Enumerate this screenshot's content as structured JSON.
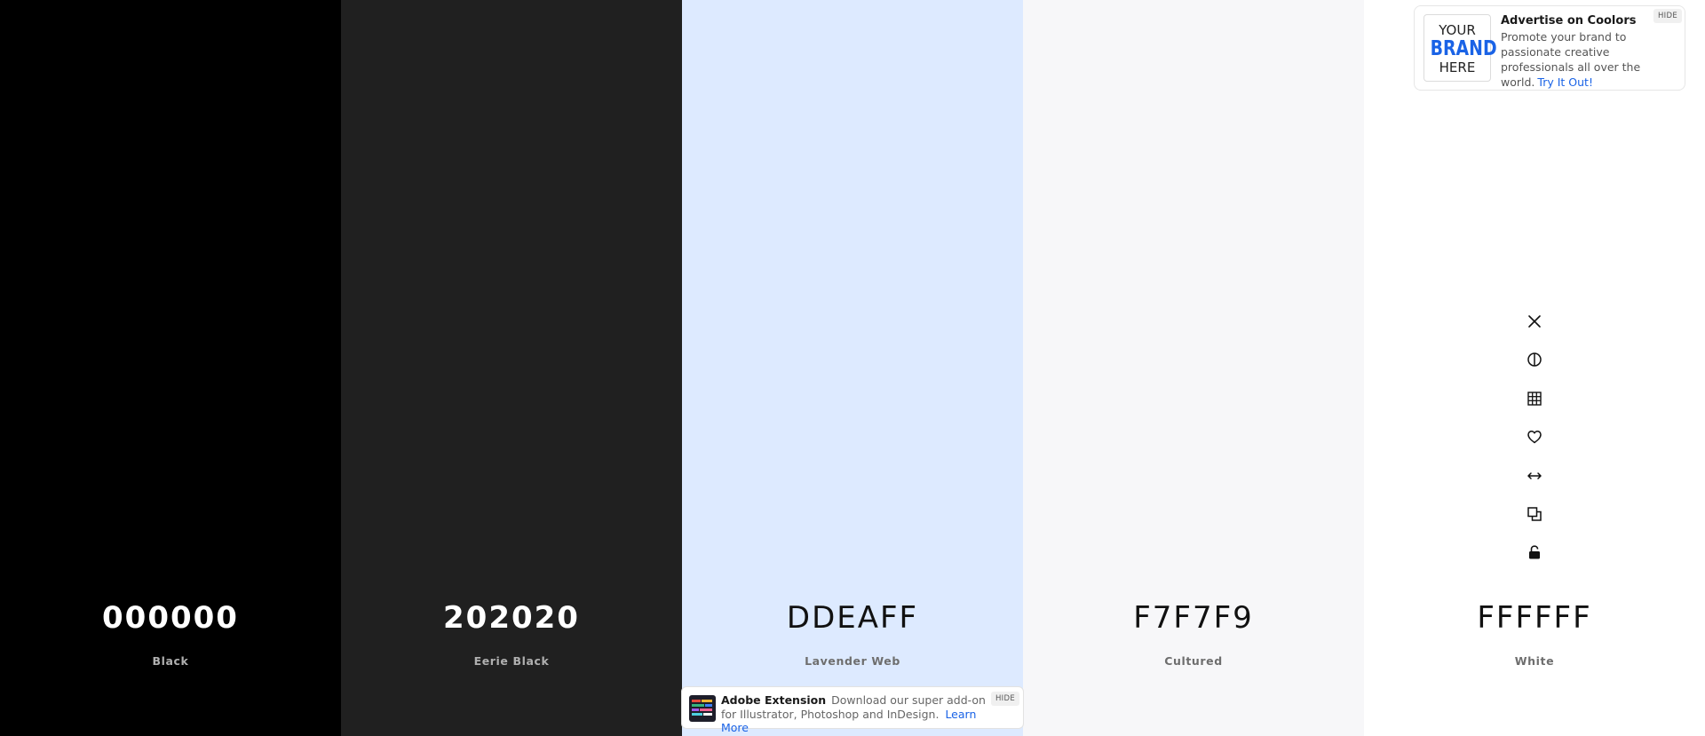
{
  "palette": [
    {
      "hex": "000000",
      "name": "Black",
      "color": "#000000",
      "tone": "dark"
    },
    {
      "hex": "202020",
      "name": "Eerie Black",
      "color": "#202020",
      "tone": "dark"
    },
    {
      "hex": "DDEAFF",
      "name": "Lavender Web",
      "color": "#DDEAFF",
      "tone": "light"
    },
    {
      "hex": "F7F7F9",
      "name": "Cultured",
      "color": "#F7F7F9",
      "tone": "light"
    },
    {
      "hex": "FFFFFF",
      "name": "White",
      "color": "#FFFFFF",
      "tone": "light"
    }
  ],
  "tools": [
    {
      "name": "remove-icon"
    },
    {
      "name": "shades-icon"
    },
    {
      "name": "grid-icon"
    },
    {
      "name": "heart-icon"
    },
    {
      "name": "drag-icon"
    },
    {
      "name": "copy-icon"
    },
    {
      "name": "lock-icon"
    }
  ],
  "ad": {
    "logo_line1": "YOUR",
    "logo_line2": "BRAND",
    "logo_line3": "HERE",
    "title": "Advertise on Coolors",
    "body": "Promote your brand to passionate creative professionals all over the world.",
    "link": "Try It Out!",
    "hide": "HIDE"
  },
  "extension": {
    "title": "Adobe Extension",
    "body": "Download our super add-on for Illustrator, Photoshop and InDesign.",
    "link": "Learn More",
    "hide": "HIDE"
  },
  "accent_color": "#1a63e6"
}
